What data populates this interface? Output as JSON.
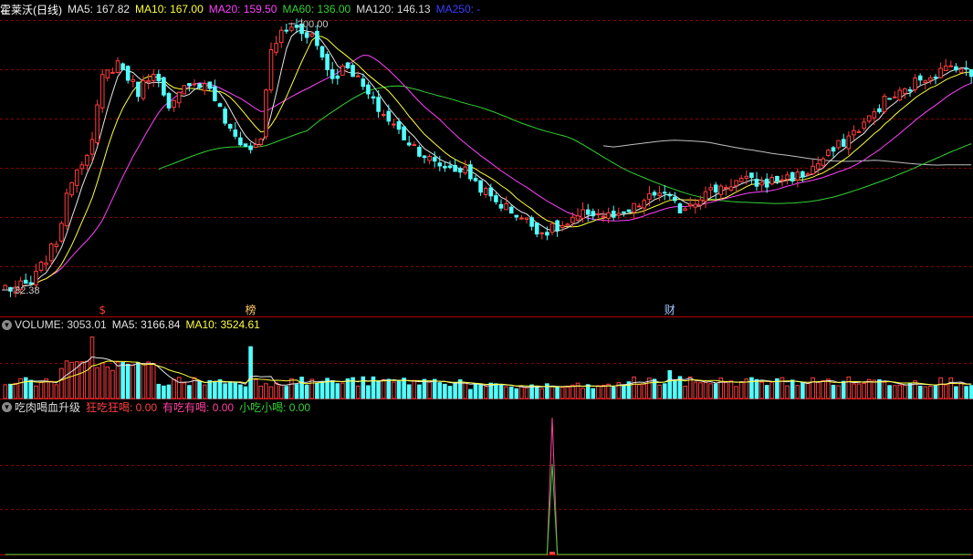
{
  "colors": {
    "up": "#ff3c3c",
    "down": "#52ffff",
    "ma5": "#e6e6e6",
    "ma10": "#ffff3c",
    "ma20": "#ff40ff",
    "ma60": "#32d232",
    "ma120": "#c0c0c0",
    "ma250": "#3c3cff",
    "grid": "#8b0000",
    "divider": "#b40000",
    "label_gray": "#c8c8c8"
  },
  "main_panel": {
    "stock_name": "霍莱沃(日线)",
    "ma5_label": "MA5: 167.82",
    "ma10_label": "MA10: 167.00",
    "ma20_label": "MA20: 159.50",
    "ma60_label": "MA60: 136.00",
    "ma120_label": "MA120: 146.13",
    "ma250_label": "MA250: -",
    "high_marker": "200.00",
    "low_marker": "82.38",
    "event_markers": [
      {
        "label": "$",
        "color": "#ff3c3c",
        "bar": 19
      },
      {
        "label": "榜",
        "color": "#ffc864",
        "bar": 48
      },
      {
        "label": "财",
        "color": "#9ec8ff",
        "bar": 130
      }
    ]
  },
  "volume_panel": {
    "title": "VOLUME: 3053.01",
    "ma5_label": "MA5: 3166.84",
    "ma10_label": "MA10: 3524.61"
  },
  "indicator_panel": {
    "title": "吃肉喝血升级",
    "line1_label": "狂吃狂喝: 0.00",
    "line2_label": "有吃有喝: 0.00",
    "line3_label": "小吃小喝: 0.00",
    "spike_bar": 107,
    "spike_value": 1
  },
  "chart_data": {
    "type": "candlestick",
    "title": "霍莱沃(日线)",
    "y_range": [
      82.38,
      200.0
    ],
    "bar_count": 190,
    "anchors": [
      [
        0,
        82.38
      ],
      [
        5,
        85
      ],
      [
        10,
        104
      ],
      [
        13,
        132
      ],
      [
        17,
        148
      ],
      [
        19,
        176
      ],
      [
        22,
        183
      ],
      [
        26,
        170
      ],
      [
        29,
        180
      ],
      [
        32,
        161
      ],
      [
        36,
        175
      ],
      [
        40,
        172
      ],
      [
        44,
        152
      ],
      [
        48,
        144
      ],
      [
        50,
        150
      ],
      [
        52,
        188
      ],
      [
        55,
        200
      ],
      [
        60,
        195
      ],
      [
        64,
        176
      ],
      [
        67,
        182
      ],
      [
        72,
        165
      ],
      [
        78,
        150
      ],
      [
        84,
        138
      ],
      [
        90,
        135
      ],
      [
        95,
        123
      ],
      [
        100,
        116
      ],
      [
        105,
        108
      ],
      [
        110,
        111
      ],
      [
        114,
        117
      ],
      [
        120,
        114
      ],
      [
        124,
        120
      ],
      [
        128,
        126
      ],
      [
        132,
        118
      ],
      [
        136,
        124
      ],
      [
        140,
        128
      ],
      [
        144,
        131
      ],
      [
        148,
        129
      ],
      [
        152,
        132
      ],
      [
        156,
        133
      ],
      [
        160,
        140
      ],
      [
        165,
        150
      ],
      [
        169,
        158
      ],
      [
        172,
        166
      ],
      [
        176,
        170
      ],
      [
        179,
        176
      ],
      [
        183,
        179
      ],
      [
        186,
        182
      ],
      [
        189,
        177
      ]
    ],
    "ma5_last": 167.82,
    "ma10_last": 167.0,
    "ma20_last": 159.5,
    "ma60_last": 136.0,
    "ma120_last": 146.13,
    "volume_last": 3053.01,
    "volume_ma5_last": 3166.84,
    "volume_ma10_last": 3524.61
  }
}
